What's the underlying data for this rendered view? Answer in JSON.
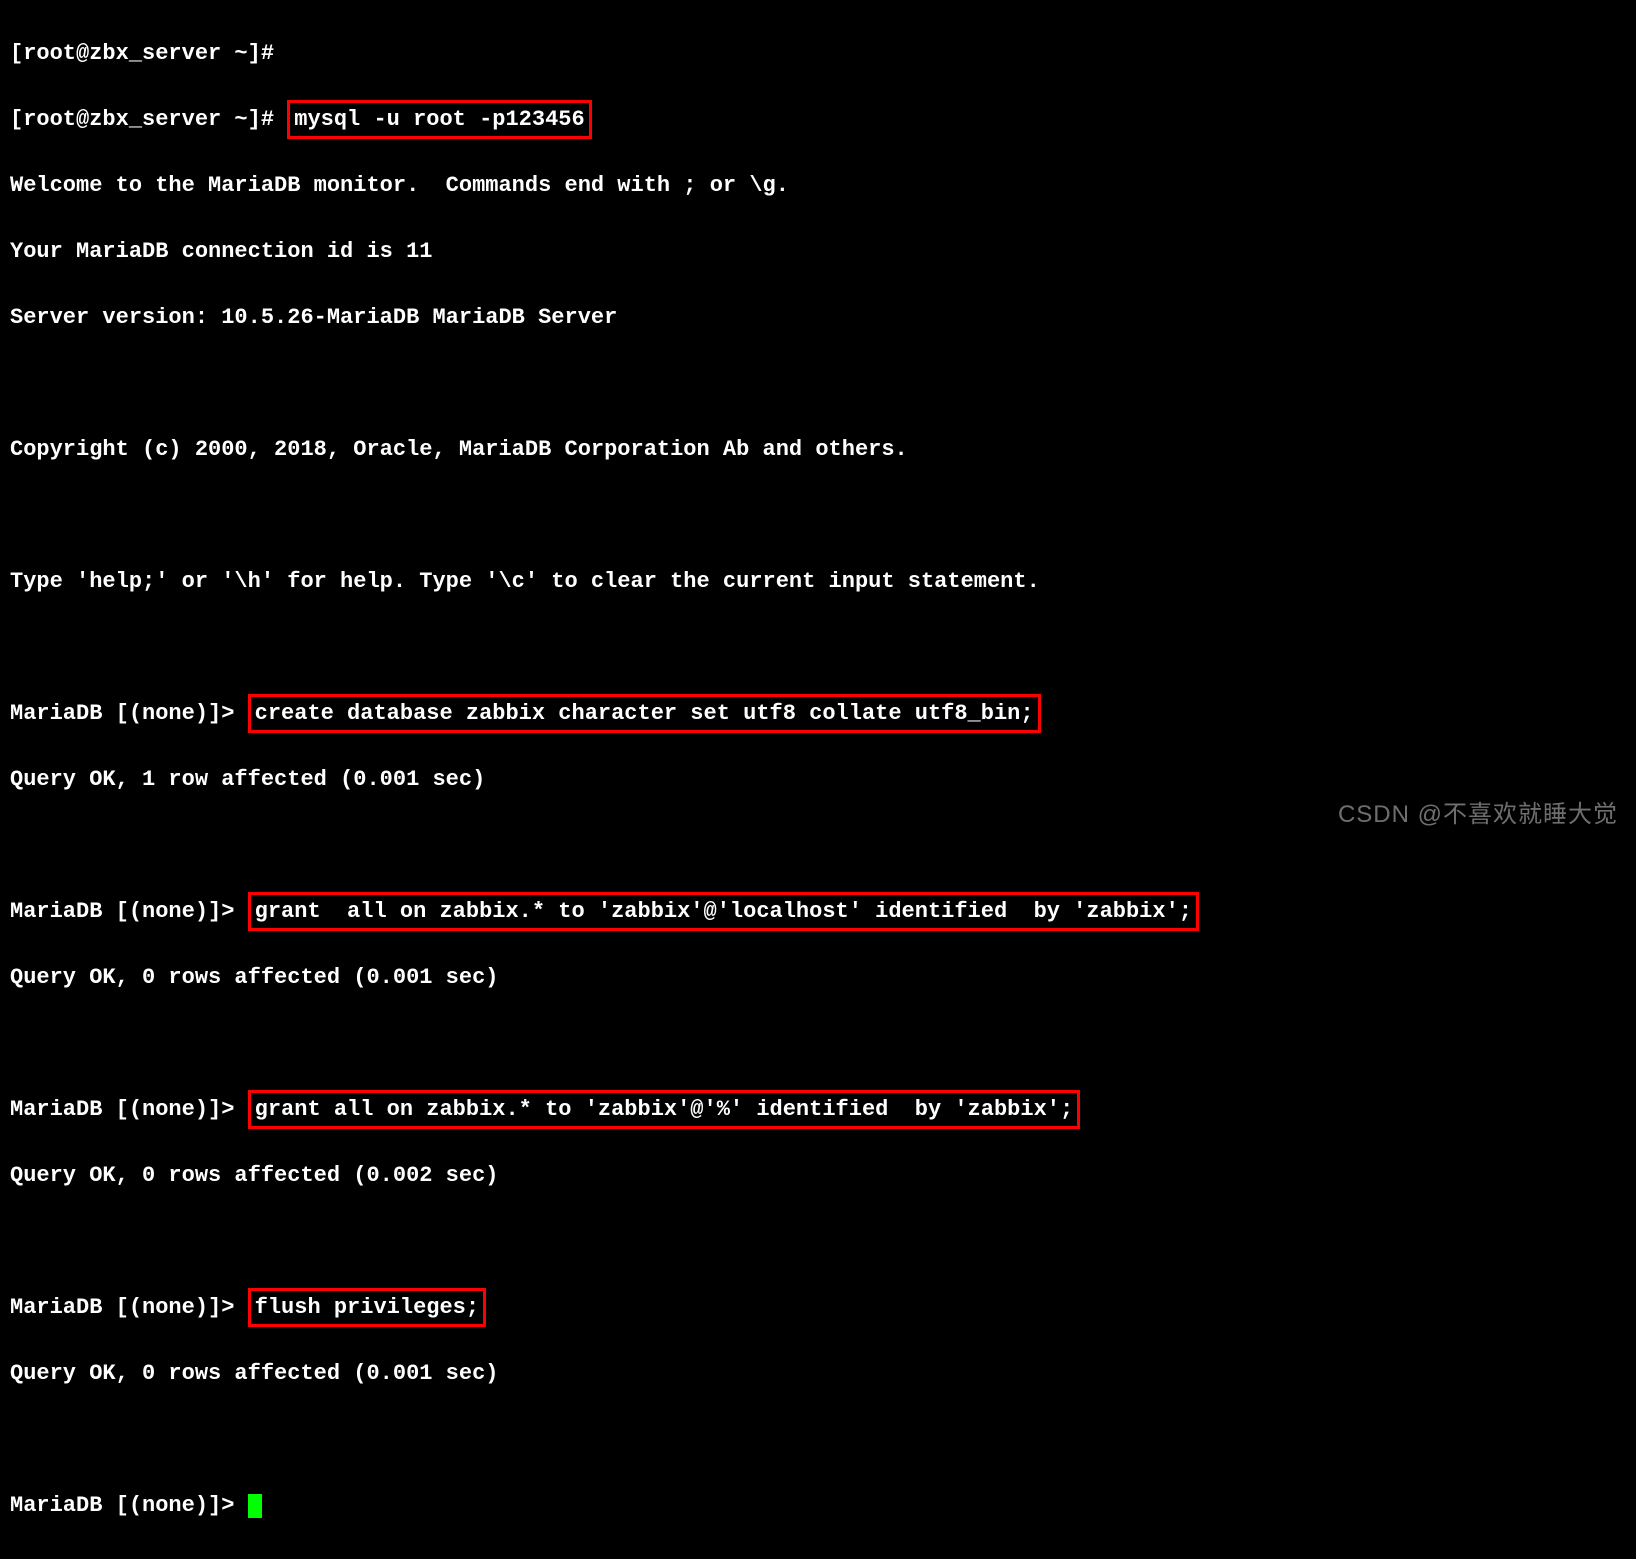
{
  "lines": {
    "l1_prompt": "[root@zbx_server ~]# ",
    "l2_prompt": "[root@zbx_server ~]# ",
    "l2_cmd": "mysql -u root -p123456",
    "l3": "Welcome to the MariaDB monitor.  Commands end with ; or \\g.",
    "l4": "Your MariaDB connection id is 11",
    "l5": "Server version: 10.5.26-MariaDB MariaDB Server",
    "l6": "",
    "l7": "Copyright (c) 2000, 2018, Oracle, MariaDB Corporation Ab and others.",
    "l8": "",
    "l9": "Type 'help;' or '\\h' for help. Type '\\c' to clear the current input statement.",
    "l10": "",
    "l11_prompt": "MariaDB [(none)]> ",
    "l11_cmd": "create database zabbix character set utf8 collate utf8_bin;",
    "l12": "Query OK, 1 row affected (0.001 sec)",
    "l13": "",
    "l14_prompt": "MariaDB [(none)]> ",
    "l14_cmd": "grant  all on zabbix.* to 'zabbix'@'localhost' identified  by 'zabbix';",
    "l15": "Query OK, 0 rows affected (0.001 sec)",
    "l16": "",
    "l17_prompt": "MariaDB [(none)]> ",
    "l17_cmd": "grant all on zabbix.* to 'zabbix'@'%' identified  by 'zabbix';",
    "l18": "Query OK, 0 rows affected (0.002 sec)",
    "l19": "",
    "l20_prompt": "MariaDB [(none)]> ",
    "l20_cmd": "flush privileges;",
    "l21": "Query OK, 0 rows affected (0.001 sec)",
    "l22": "",
    "l23_prompt": "MariaDB [(none)]> "
  },
  "watermark": "CSDN @不喜欢就睡大觉"
}
